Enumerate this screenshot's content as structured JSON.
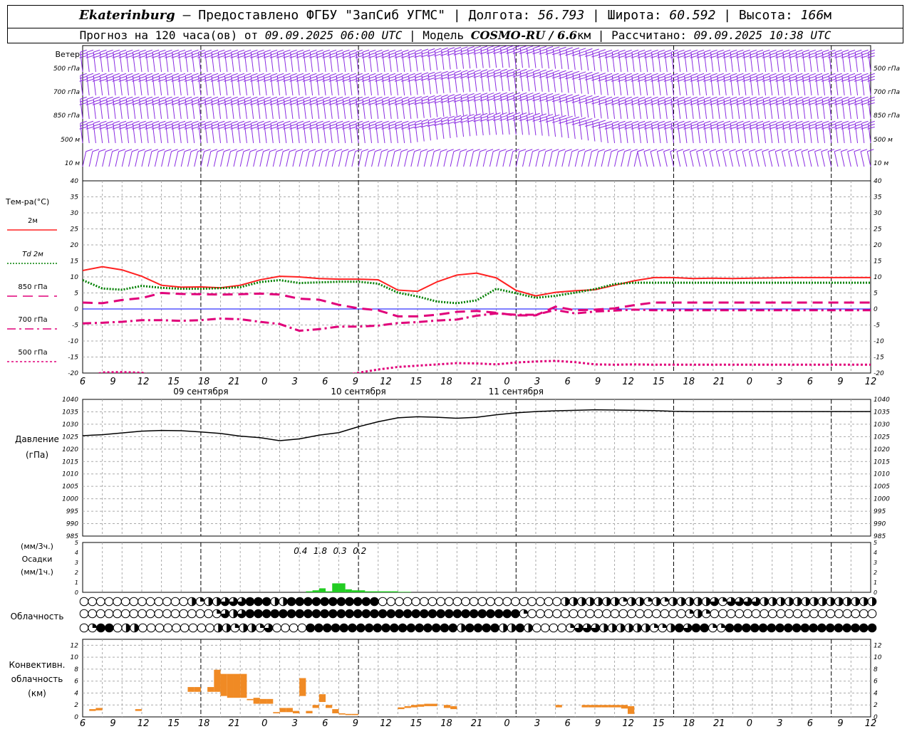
{
  "header": {
    "city": "Ekaterinburg",
    "provider": " – Предоставлено ФГБУ \"ЗапСиб УГМС\" | ",
    "lon_label": "Долгота: ",
    "lon": "56.793",
    "lat_label": " | Широта: ",
    "lat": "60.592",
    "alt_label": " | Высота: ",
    "alt": "166",
    "alt_unit": "м",
    "forecast_label": "Прогноз на 120 часа(ов) от ",
    "init_time": "09.09.2025 06:00 UTC",
    "model_label": " | Модель ",
    "model": "COSMO-RU / 6.6",
    "model_unit": "км",
    "calc_label": " | Рассчитано: ",
    "calc_time": "09.09.2025 10:38 UTC"
  },
  "labels": {
    "wind_title": "Ветер",
    "wind_levels": [
      "500 гПа",
      "700 гПа",
      "850 гПа",
      "500 м",
      "10 м"
    ],
    "temp_title": "Тем-ра(°С)",
    "temp_legend": [
      "2м",
      "Td  2м",
      "850 гПа",
      "700 гПа",
      "500 гПа"
    ],
    "pressure_title": [
      "Давление",
      "(гПа)"
    ],
    "precip_title": [
      "(мм/3ч.)",
      "Осадки",
      "(мм/1ч.)"
    ],
    "cloud_title": "Облачность",
    "conv_title": [
      "Конвективн.",
      "облачность",
      "(км)"
    ]
  },
  "colors": {
    "t2m": "#ff2020",
    "td2m": "#008000",
    "t850": "#e0007a",
    "t700": "#e0007a",
    "t500": "#e0007a",
    "wind": "#8a2be2",
    "pressure": "#000000",
    "precip": "#22cc22",
    "conv": "#f08a24",
    "zero": "#0000ff"
  },
  "chart_data": [
    {
      "type": "line",
      "name": "temperature",
      "x_hours": [
        0,
        3,
        6,
        9,
        12,
        15,
        18,
        21,
        24,
        27,
        30,
        33,
        36,
        39,
        42,
        45,
        48,
        51,
        54,
        57,
        60,
        63,
        66,
        69,
        72,
        75,
        78,
        81,
        84,
        87,
        90,
        93,
        96,
        99,
        102,
        105,
        108,
        111,
        114,
        117,
        120
      ],
      "x_tick_labels": [
        "6",
        "9",
        "12",
        "15",
        "18",
        "21",
        "0",
        "3",
        "6",
        "9",
        "12",
        "15",
        "18",
        "21",
        "0",
        "3",
        "6",
        "9",
        "12",
        "15",
        "18",
        "21",
        "0",
        "3",
        "6",
        "9",
        "12"
      ],
      "day_labels": [
        "09 сентября",
        "10 сентября",
        "11 сентября"
      ],
      "ylim": [
        -20,
        40
      ],
      "yticks": [
        -20,
        -15,
        -10,
        -5,
        0,
        5,
        10,
        15,
        20,
        25,
        30,
        35,
        40
      ],
      "series": [
        {
          "name": "2м",
          "values": [
            12,
            13.2,
            12.2,
            10.2,
            7.4,
            6.8,
            6.9,
            6.6,
            7.4,
            9.1,
            10.2,
            10,
            9.5,
            9.3,
            9.3,
            9.1,
            5.9,
            5.5,
            8.5,
            10.6,
            11.2,
            9.7,
            5.8,
            4.1,
            5.2,
            5.7,
            6.0,
            7.4,
            8.8,
            9.8,
            9.8,
            9.5,
            9.6,
            9.5,
            9.6,
            9.7,
            9.8,
            9.8,
            9.8,
            9.8,
            9.8
          ]
        },
        {
          "name": "Td  2м",
          "values": [
            9,
            6.4,
            6.0,
            7.2,
            6.6,
            6.3,
            6.3,
            6.5,
            6.8,
            8.4,
            9.0,
            8.1,
            8.3,
            8.5,
            8.5,
            7.9,
            5.1,
            3.9,
            2.3,
            1.8,
            2.7,
            6.3,
            4.9,
            3.5,
            4.1,
            5.1,
            6.2,
            7.8,
            8.2,
            8.2,
            8.2,
            8.2,
            8.2,
            8.2,
            8.2,
            8.2,
            8.2,
            8.2,
            8.2,
            8.2,
            8.2
          ]
        },
        {
          "name": "850 гПа",
          "values": [
            2,
            1.8,
            2.8,
            3.4,
            5.0,
            4.7,
            4.6,
            4.5,
            4.6,
            4.8,
            4.5,
            3.2,
            2.9,
            1.3,
            0.2,
            -0.4,
            -2.3,
            -2.3,
            -1.8,
            -0.9,
            -0.6,
            -1.2,
            -2.0,
            -2.0,
            0.7,
            -0.4,
            -0.2,
            0.2,
            1.2,
            2.0,
            2.0,
            2.0,
            2.0,
            2.0,
            2.0,
            2.0,
            2.0,
            2.0,
            2.0,
            2.0,
            2.0
          ]
        },
        {
          "name": "700 гПа",
          "values": [
            -4.5,
            -4.3,
            -4.0,
            -3.5,
            -3.5,
            -3.7,
            -3.5,
            -3.0,
            -3.2,
            -4.0,
            -4.7,
            -6.8,
            -6.3,
            -5.5,
            -5.5,
            -5.2,
            -4.4,
            -4.1,
            -3.6,
            -3.3,
            -2.1,
            -1.4,
            -1.8,
            -1.8,
            -0.3,
            -1.4,
            -0.8,
            -0.5,
            -0.2,
            -0.4,
            -0.4,
            -0.4,
            -0.4,
            -0.4,
            -0.4,
            -0.4,
            -0.4,
            -0.4,
            -0.4,
            -0.4,
            -0.4
          ]
        },
        {
          "name": "500 гПа",
          "values": [
            -21.8,
            -19.8,
            -19.7,
            -19.9,
            -21.6,
            -20.4,
            -20.5,
            -20.8,
            -21.5,
            -22.8,
            -23.0,
            -22.5,
            -21.5,
            -21.0,
            -19.9,
            -18.9,
            -18.1,
            -17.7,
            -17.3,
            -16.9,
            -17.0,
            -17.3,
            -16.7,
            -16.4,
            -16.2,
            -16.6,
            -17.3,
            -17.4,
            -17.3,
            -17.4,
            -17.4,
            -17.4,
            -17.4,
            -17.4,
            -17.4,
            -17.4,
            -17.4,
            -17.4,
            -17.4,
            -17.4,
            -17.4
          ]
        }
      ]
    },
    {
      "type": "line",
      "name": "pressure",
      "x_hours": [
        0,
        3,
        6,
        9,
        12,
        15,
        18,
        21,
        24,
        27,
        30,
        33,
        36,
        39,
        42,
        45,
        48,
        51,
        54,
        57,
        60,
        63,
        66,
        69,
        72,
        75,
        78,
        81,
        84,
        87,
        90,
        93,
        96,
        99,
        102,
        105,
        108,
        111,
        114,
        117,
        120
      ],
      "ylim": [
        985,
        1040
      ],
      "yticks": [
        985,
        990,
        995,
        1000,
        1005,
        1010,
        1015,
        1020,
        1025,
        1030,
        1035,
        1040
      ],
      "series": [
        {
          "name": "Давление",
          "values": [
            1025.4,
            1025.8,
            1026.5,
            1027.2,
            1027.5,
            1027.4,
            1026.9,
            1026.3,
            1025.2,
            1024.6,
            1023.4,
            1024.1,
            1025.6,
            1026.6,
            1029.0,
            1031.0,
            1032.6,
            1033.0,
            1032.8,
            1032.4,
            1032.8,
            1033.8,
            1034.6,
            1035.1,
            1035.4,
            1035.6,
            1035.8,
            1035.7,
            1035.6,
            1035.5,
            1035.2,
            1035.1,
            1035.1,
            1035.1,
            1035.1,
            1035.1,
            1035.1,
            1035.1,
            1035.1,
            1035.1,
            1035.1
          ]
        }
      ]
    },
    {
      "type": "bar",
      "name": "precipitation",
      "ylim": [
        0,
        5
      ],
      "yticks": [
        0,
        1,
        2,
        3,
        4,
        5
      ],
      "labels_3h": [
        {
          "hour": 36,
          "value": "0.4"
        },
        {
          "hour": 39,
          "value": "1.8"
        },
        {
          "hour": 42,
          "value": "0.3"
        },
        {
          "hour": 45,
          "value": "0.2"
        }
      ],
      "hours": [
        34,
        35,
        36,
        37,
        38,
        39,
        40,
        41,
        42,
        43,
        44,
        45,
        46,
        47,
        48,
        49
      ],
      "values": [
        0.1,
        0.2,
        0.4,
        0.1,
        0.9,
        0.9,
        0.3,
        0.2,
        0.2,
        0.1,
        0.1,
        0.1,
        0.1,
        0.1,
        0.05,
        0.05
      ]
    },
    {
      "type": "bar",
      "name": "convective_cloud",
      "ylim": [
        0,
        13
      ],
      "yticks": [
        0,
        2,
        4,
        6,
        8,
        10,
        12
      ],
      "bars": [
        {
          "hour": 1,
          "base": 1.0,
          "top": 1.3
        },
        {
          "hour": 2,
          "base": 1.1,
          "top": 1.5
        },
        {
          "hour": 8,
          "base": 1.0,
          "top": 1.3
        },
        {
          "hour": 16,
          "base": 4.2,
          "top": 5.0
        },
        {
          "hour": 17,
          "base": 4.2,
          "top": 5.0
        },
        {
          "hour": 19,
          "base": 4.2,
          "top": 5.0
        },
        {
          "hour": 20,
          "base": 4.2,
          "top": 7.9
        },
        {
          "hour": 21,
          "base": 3.5,
          "top": 7.2
        },
        {
          "hour": 22,
          "base": 3.2,
          "top": 7.2
        },
        {
          "hour": 23,
          "base": 3.2,
          "top": 7.2
        },
        {
          "hour": 24,
          "base": 3.2,
          "top": 7.2
        },
        {
          "hour": 25,
          "base": 2.8,
          "top": 3.0
        },
        {
          "hour": 26,
          "base": 2.2,
          "top": 3.2
        },
        {
          "hour": 27,
          "base": 2.2,
          "top": 3.0
        },
        {
          "hour": 28,
          "base": 2.2,
          "top": 3.0
        },
        {
          "hour": 29,
          "base": 0.6,
          "top": 0.8
        },
        {
          "hour": 30,
          "base": 0.8,
          "top": 1.5
        },
        {
          "hour": 31,
          "base": 0.8,
          "top": 1.5
        },
        {
          "hour": 32,
          "base": 0.6,
          "top": 1.0
        },
        {
          "hour": 33,
          "base": 3.5,
          "top": 6.5
        },
        {
          "hour": 34,
          "base": 0.6,
          "top": 1.0
        },
        {
          "hour": 35,
          "base": 1.5,
          "top": 2.0
        },
        {
          "hour": 36,
          "base": 2.5,
          "top": 3.8
        },
        {
          "hour": 37,
          "base": 1.5,
          "top": 2.0
        },
        {
          "hour": 38,
          "base": 0.6,
          "top": 1.3
        },
        {
          "hour": 39,
          "base": 0.4,
          "top": 0.6
        },
        {
          "hour": 40,
          "base": 0.3,
          "top": 0.5
        },
        {
          "hour": 41,
          "base": 0.3,
          "top": 0.5
        },
        {
          "hour": 48,
          "base": 1.3,
          "top": 1.6
        },
        {
          "hour": 49,
          "base": 1.5,
          "top": 1.8
        },
        {
          "hour": 50,
          "base": 1.6,
          "top": 2.0
        },
        {
          "hour": 51,
          "base": 1.7,
          "top": 2.1
        },
        {
          "hour": 52,
          "base": 1.8,
          "top": 2.2
        },
        {
          "hour": 53,
          "base": 1.8,
          "top": 2.2
        },
        {
          "hour": 55,
          "base": 1.5,
          "top": 2.0
        },
        {
          "hour": 56,
          "base": 1.3,
          "top": 1.8
        },
        {
          "hour": 72,
          "base": 1.6,
          "top": 2.0
        },
        {
          "hour": 76,
          "base": 1.6,
          "top": 2.0
        },
        {
          "hour": 77,
          "base": 1.6,
          "top": 2.0
        },
        {
          "hour": 78,
          "base": 1.6,
          "top": 2.0
        },
        {
          "hour": 79,
          "base": 1.6,
          "top": 2.0
        },
        {
          "hour": 80,
          "base": 1.6,
          "top": 2.0
        },
        {
          "hour": 81,
          "base": 1.6,
          "top": 2.0
        },
        {
          "hour": 82,
          "base": 1.4,
          "top": 2.0
        },
        {
          "hour": 83,
          "base": 0.5,
          "top": 1.8
        }
      ]
    }
  ],
  "cloud_rows": {
    "legend": "o=0 clear, q=quarter, h=half, t=three-quarter, f=full",
    "upper": "ooooooooooooohqhhtttfffhhfffffffffffoooooooooooooooooooooohhhhhhhqhhqhqhhhhhtqtttthhhhhhhhhhhhhh",
    "middle": "ooooooooooooooooqthtfffffffffffffffffffffffffffffffffqoooooooooooooooooooqhqoooooooooooooooooooo",
    "lower": "oqffohhooooooooohhqhhqtooooffffffffffffffffffhffffhhfhooooqttthhhhhhqqhftffqqffffffffffffffffff"
  }
}
